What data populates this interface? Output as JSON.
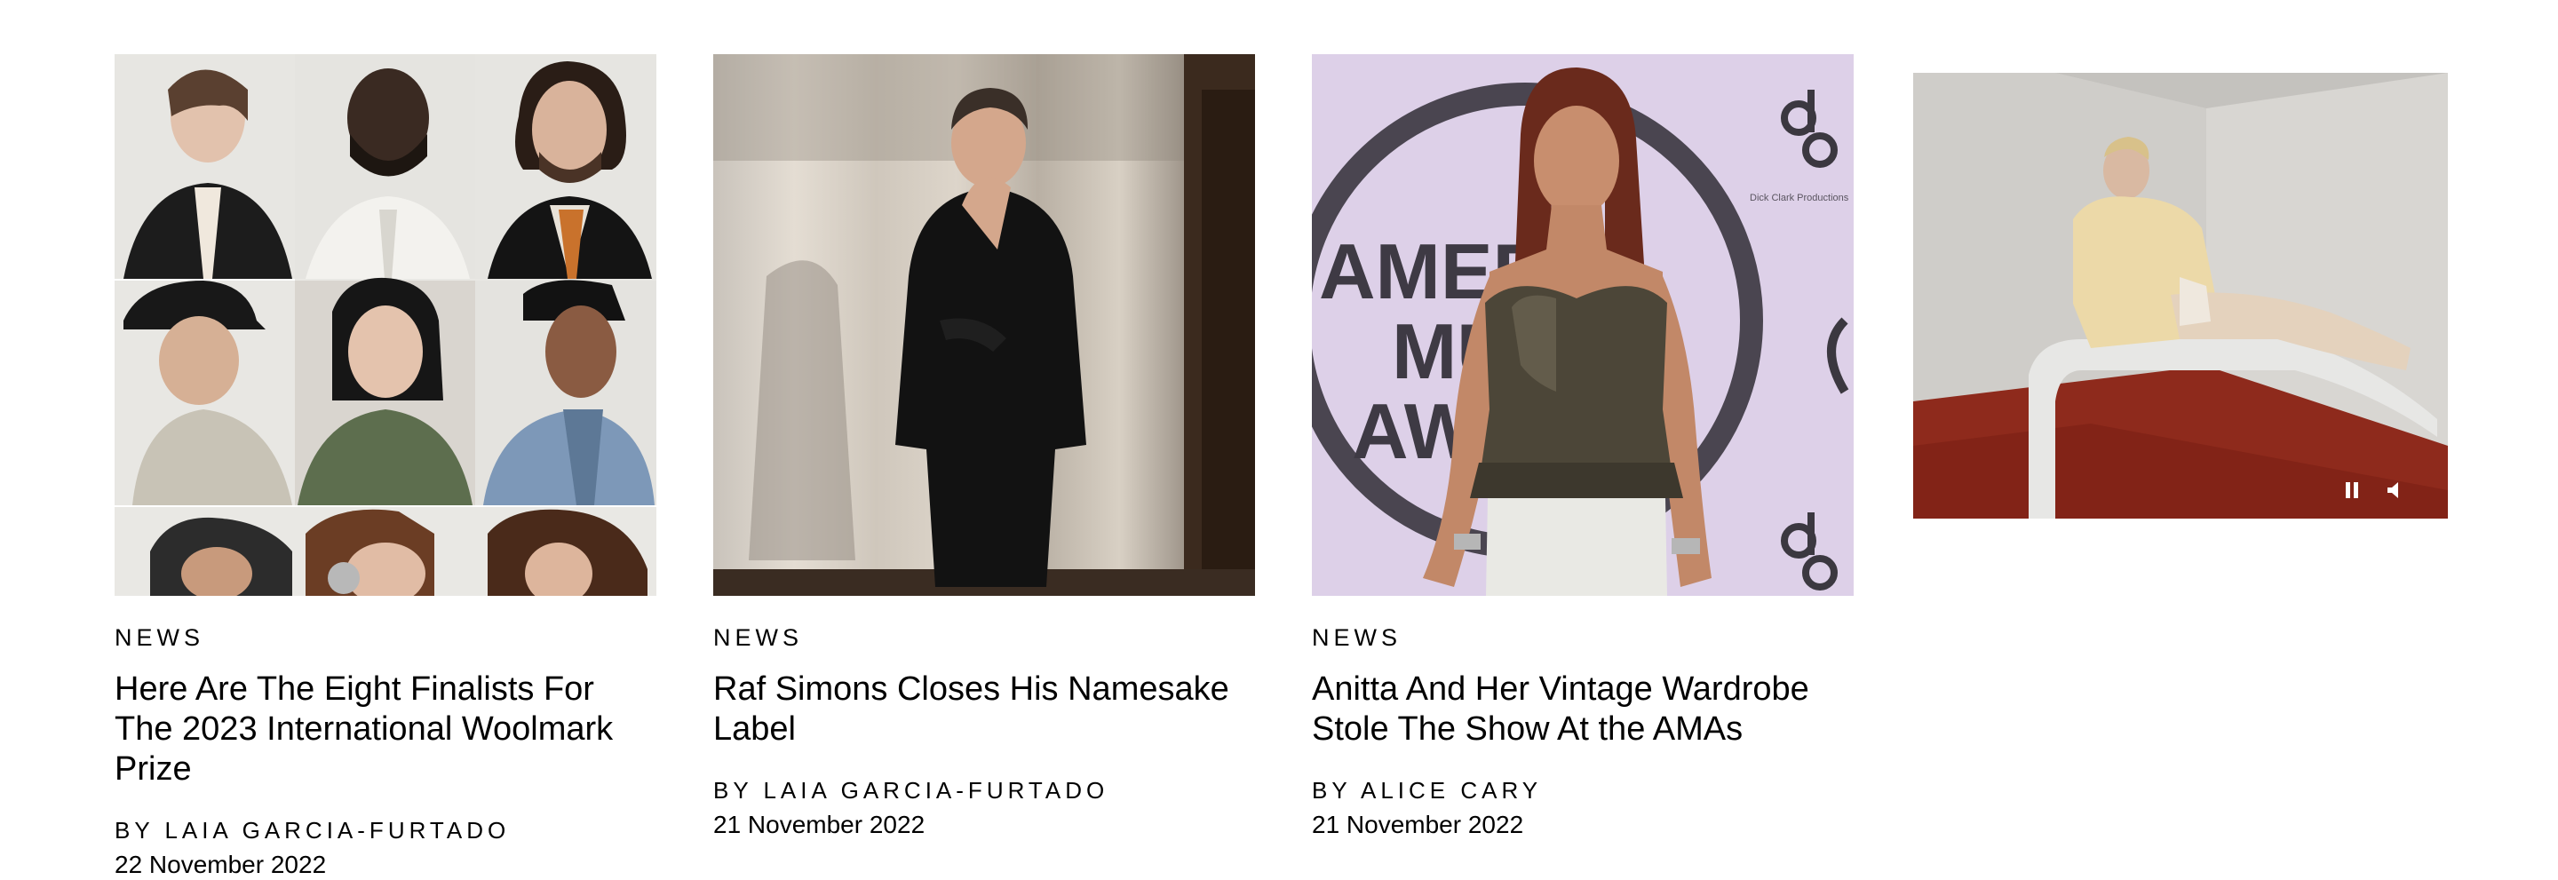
{
  "articles": [
    {
      "rubric": "NEWS",
      "headline": "Here Are The Eight Finalists For The 2023 International Woolmark Prize",
      "byline": "BY LAIA GARCIA-FURTADO",
      "date": "22 November 2022"
    },
    {
      "rubric": "NEWS",
      "headline": "Raf Simons Closes His Namesake Label",
      "byline": "BY LAIA GARCIA-FURTADO",
      "date": "21 November 2022"
    },
    {
      "rubric": "NEWS",
      "headline": "Anitta And Her Vintage Wardrobe Stole The Show At the AMAs",
      "byline": "BY ALICE CARY",
      "date": "21 November 2022"
    }
  ],
  "image3": {
    "backdrop_text": "AMER MU AW",
    "logo_text": "dcp",
    "logo_caption": "Dick Clark Productions"
  },
  "video": {
    "controls": [
      "pause-icon",
      "speaker-icon"
    ]
  }
}
